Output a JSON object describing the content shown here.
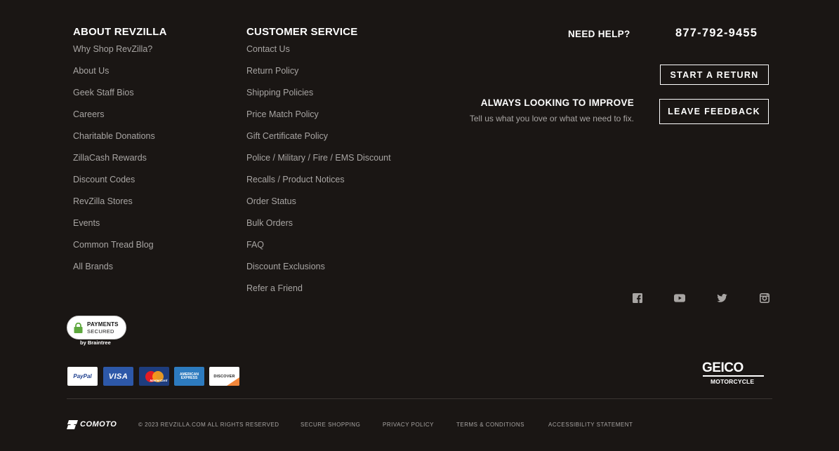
{
  "about": {
    "title": "ABOUT REVZILLA",
    "items": [
      "Why Shop RevZilla?",
      "About Us",
      "Geek Staff Bios",
      "Careers",
      "Charitable Donations",
      "ZillaCash Rewards",
      "Discount Codes",
      "RevZilla Stores",
      "Events",
      "Common Tread Blog",
      "All Brands"
    ]
  },
  "service": {
    "title": "CUSTOMER SERVICE",
    "items": [
      "Contact Us",
      "Return Policy",
      "Shipping Policies",
      "Price Match Policy",
      "Gift Certificate Policy",
      "Police / Military / Fire / EMS Discount",
      "Recalls / Product Notices",
      "Order Status",
      "Bulk Orders",
      "FAQ",
      "Discount Exclusions",
      "Refer a Friend"
    ]
  },
  "help": {
    "label": "NEED HELP?",
    "phone": "877-792-9455",
    "return_button": "START A RETURN"
  },
  "improve": {
    "title": "ALWAYS LOOKING TO IMPROVE",
    "subtitle": "Tell us what you love or what we need to fix.",
    "feedback_button": "LEAVE FEEDBACK"
  },
  "social": {
    "icons": [
      "facebook-icon",
      "youtube-icon",
      "twitter-icon",
      "instagram-icon"
    ]
  },
  "payments": {
    "badge_line1": "PAYMENTS",
    "badge_line2": "SECURED",
    "badge_by": "by Braintree",
    "cards": [
      "PayPal",
      "VISA",
      "MasterCard",
      "AMERICAN EXPRESS",
      "DISCOVER"
    ]
  },
  "sponsor": {
    "brand": "GEICO",
    "tagline": "MOTORCYCLE"
  },
  "bottom": {
    "brand": "COMOTO",
    "copyright": "© 2023 REVZILLA.COM ALL RIGHTS RESERVED",
    "links": [
      "SECURE SHOPPING",
      "PRIVACY POLICY",
      "TERMS & CONDITIONS",
      "ACCESSIBILITY STATEMENT"
    ]
  },
  "colors": {
    "background": "#1a1614",
    "link_text": "#a8a5a3",
    "heading": "#ffffff",
    "divider": "#3a3532"
  }
}
